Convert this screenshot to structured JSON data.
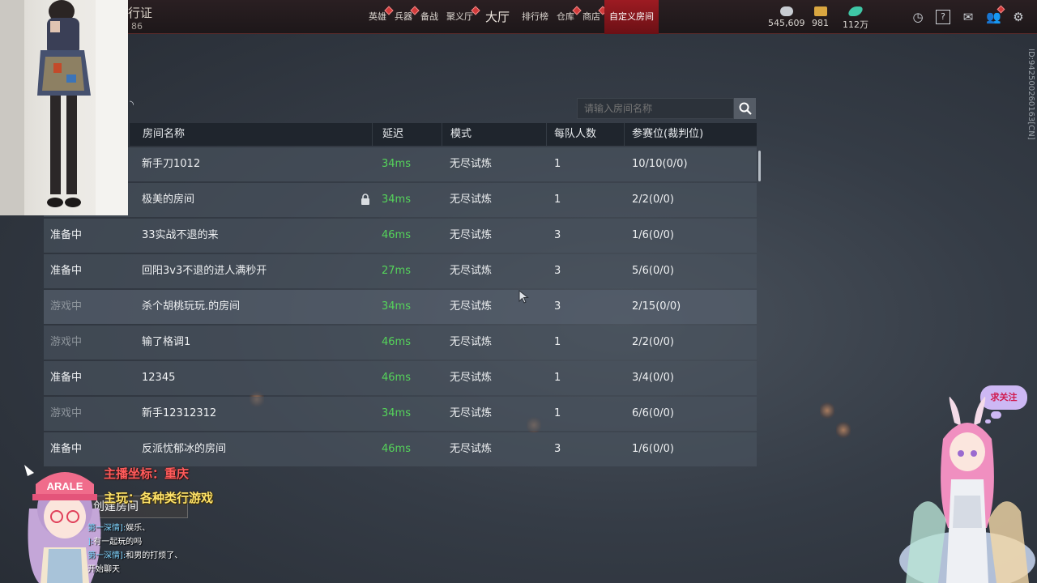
{
  "header": {
    "pass_title": "行证",
    "pass_level": "86",
    "nav": [
      {
        "label": "英雄",
        "dot": true
      },
      {
        "label": "兵器",
        "dot": true
      },
      {
        "label": "备战",
        "dot": false
      },
      {
        "label": "聚义厅",
        "dot": true
      },
      {
        "label": "大厅",
        "dot": false,
        "big": true
      },
      {
        "label": "排行榜",
        "dot": false
      },
      {
        "label": "仓库",
        "dot": true
      },
      {
        "label": "商店",
        "dot": true
      },
      {
        "label": "自定义房间",
        "dot": false,
        "active": true
      }
    ],
    "currencies": [
      {
        "value": "545,609",
        "icon": "coin-stack-icon",
        "color": "#c8ccd2"
      },
      {
        "value": "981",
        "icon": "gold-ticket-icon",
        "color": "#d9a640"
      },
      {
        "value": "112万",
        "icon": "feather-icon",
        "color": "#3fc7a6"
      }
    ],
    "icons": [
      "timer-icon",
      "help-icon",
      "mail-icon",
      "friends-icon",
      "settings-icon"
    ],
    "side_id": "ID:94250026016​3[CN]"
  },
  "search": {
    "placeholder": "请输入房间名称"
  },
  "table": {
    "columns": [
      "房间名称",
      "延迟",
      "模式",
      "每队人数",
      "参赛位(裁判位)"
    ],
    "rows": [
      {
        "status": "",
        "name": "新手刀1012",
        "locked": false,
        "ping": "34ms",
        "mode": "无尽试炼",
        "per_team": "1",
        "slots": "10/10(0/0)"
      },
      {
        "status": "",
        "name": "极美的房间",
        "locked": true,
        "ping": "34ms",
        "mode": "无尽试炼",
        "per_team": "1",
        "slots": "2/2(0/0)"
      },
      {
        "status": "准备中",
        "name": "33实战不退的来",
        "locked": false,
        "ping": "46ms",
        "mode": "无尽试炼",
        "per_team": "3",
        "slots": "1/6(0/0)"
      },
      {
        "status": "准备中",
        "name": "回阳3v3不退的进人满秒开",
        "locked": false,
        "ping": "27ms",
        "mode": "无尽试炼",
        "per_team": "3",
        "slots": "5/6(0/0)"
      },
      {
        "status": "游戏中",
        "name": "杀个胡桃玩玩.的房间",
        "locked": false,
        "ping": "34ms",
        "mode": "无尽试炼",
        "per_team": "3",
        "slots": "2/15(0/0)"
      },
      {
        "status": "游戏中",
        "name": "输了格调1",
        "locked": false,
        "ping": "46ms",
        "mode": "无尽试炼",
        "per_team": "1",
        "slots": "2/2(0/0)"
      },
      {
        "status": "准备中",
        "name": "12345",
        "locked": false,
        "ping": "46ms",
        "mode": "无尽试炼",
        "per_team": "1",
        "slots": "3/4(0/0)"
      },
      {
        "status": "游戏中",
        "name": "新手12312312",
        "locked": false,
        "ping": "34ms",
        "mode": "无尽试炼",
        "per_team": "1",
        "slots": "6/6(0/0)"
      },
      {
        "status": "准备中",
        "name": "反派忧郁冰的房间",
        "locked": false,
        "ping": "46ms",
        "mode": "无尽试炼",
        "per_team": "3",
        "slots": "1/6(0/0)"
      }
    ]
  },
  "create_room_label": "创建房间",
  "stream": {
    "anchor_location": "主播坐标：重庆",
    "anchor_games": "主玩：各种类行游戏",
    "hat_text": "ARALE",
    "follow_label": "求关注",
    "chat": [
      {
        "who": "第一深情]:",
        "text": "娱乐、"
      },
      {
        "who": "]:",
        "text": "有一起玩的吗"
      },
      {
        "who": "第一深情]:",
        "text": "和男的打烦了、"
      },
      {
        "who": "",
        "text": "开始聊天"
      }
    ]
  }
}
